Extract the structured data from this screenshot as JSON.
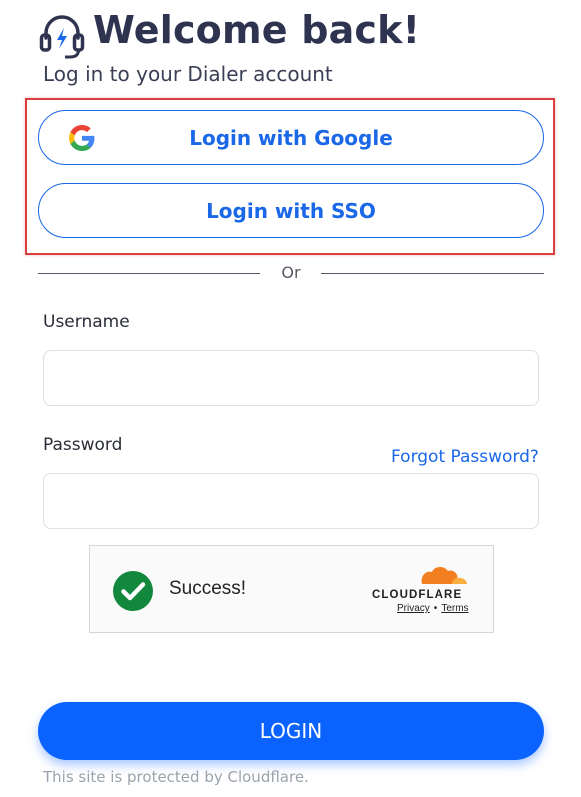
{
  "header": {
    "title": "Welcome back!",
    "subtitle": "Log in to your Dialer account",
    "logo_icon": "headset-bolt-icon"
  },
  "oauth": {
    "google_label": "Login with Google",
    "google_icon": "google-g-icon",
    "sso_label": "Login with SSO",
    "highlight_color": "#d93f3f"
  },
  "divider": {
    "text": "Or"
  },
  "form": {
    "username_label": "Username",
    "username_value": "",
    "password_label": "Password",
    "password_value": "",
    "forgot_password_label": "Forgot Password?"
  },
  "captcha": {
    "status_text": "Success!",
    "status_icon": "check-circle-icon",
    "brand_logo": "cloudflare-logo",
    "privacy_label": "Privacy",
    "separator": "•",
    "terms_label": "Terms"
  },
  "login_button": {
    "label": "LOGIN"
  },
  "footer": {
    "note": "This site is protected by Cloudflare."
  },
  "colors": {
    "accent": "#1a67e8",
    "primary_button": "#0a62ff",
    "title": "#2e3350",
    "success": "#12883d",
    "cloudflare_orange": "#f38020"
  }
}
